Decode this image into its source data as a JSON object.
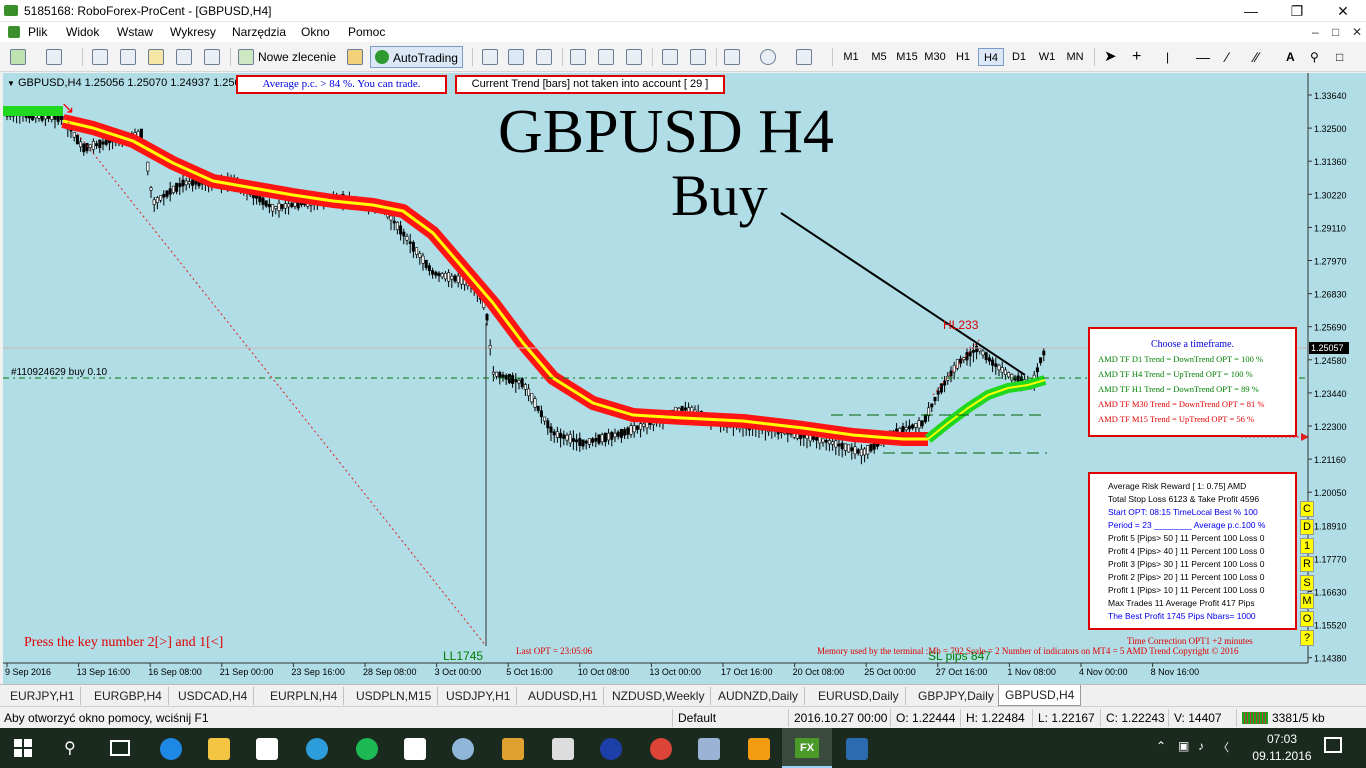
{
  "window": {
    "title": "5185168: RoboForex-ProCent - [GBPUSD,H4]"
  },
  "menu": {
    "items": [
      "Plik",
      "Widok",
      "Wstaw",
      "Wykresy",
      "Narzędzia",
      "Okno",
      "Pomoc"
    ]
  },
  "toolbar": {
    "new_order": "Nowe zlecenie",
    "autotrading": "AutoTrading",
    "timeframes": [
      "M1",
      "M5",
      "M15",
      "M30",
      "H1",
      "H4",
      "D1",
      "W1",
      "MN"
    ],
    "selected_tf": "H4"
  },
  "chart": {
    "info": "GBPUSD,H4  1.25056 1.25070 1.24937 1.25057",
    "box_avg": "Average p.c. > 84 %.  You can trade.",
    "box_trend": "Current Trend [bars] not taken into account [ 29 ]",
    "big_title": "GBPUSD H4",
    "big_signal": "Buy",
    "order_line": "#110924629 buy 0.10",
    "hl_label": "HL233",
    "ll_label": "LL1745",
    "sl_label": "SL pips 847",
    "press_key": "Press the key number 2[>] and 1[<]",
    "last_opt": "Last OPT = 23:05:06",
    "memory": "Memory used by the terminal :Mb = 792  Scale = 2   Number of indicators on MT4 = 5 AMD Trend Copyright © 2016",
    "time_corr": "Time Correction OPT1 +2 minutes",
    "current_price": "1.25057",
    "price_axis": [
      "1.33640",
      "1.32500",
      "1.31360",
      "1.30220",
      "1.29110",
      "1.27970",
      "1.26830",
      "1.25690",
      "1.24580",
      "1.23440",
      "1.22300",
      "1.21160",
      "1.20050",
      "1.18910",
      "1.17770",
      "1.16630",
      "1.15520",
      "1.14380"
    ],
    "time_axis": [
      "9 Sep 2016",
      "13 Sep 16:00",
      "16 Sep 08:00",
      "21 Sep 00:00",
      "23 Sep 16:00",
      "28 Sep 08:00",
      "3 Oct 00:00",
      "5 Oct 16:00",
      "10 Oct 08:00",
      "13 Oct 00:00",
      "17 Oct 16:00",
      "20 Oct 08:00",
      "25 Oct 00:00",
      "27 Oct 16:00",
      "1 Nov 08:00",
      "4 Nov 00:00",
      "8 Nov 16:00"
    ]
  },
  "tf_panel": {
    "title": "Choose a timeframe.",
    "rows": [
      {
        "text": "AMD TF D1  Trend = DownTrend  OPT = 100 %",
        "color": "#008000"
      },
      {
        "text": "AMD TF H4  Trend = UpTrend  OPT = 100 %",
        "color": "#008000"
      },
      {
        "text": "AMD TF H1  Trend = DownTrend  OPT = 89 %",
        "color": "#008000"
      },
      {
        "text": "AMD TF M30  Trend = DownTrend  OPT = 81 %",
        "color": "#e00000"
      },
      {
        "text": "AMD TF M15  Trend = UpTrend  OPT = 56 %",
        "color": "#e00000"
      }
    ]
  },
  "stats_panel": {
    "rows": [
      {
        "text": "Average Risk Reward [ 1: 0.75]  AMD",
        "color": "#000000"
      },
      {
        "text": "Total Stop Loss  6123 & Take Profit 4596",
        "color": "#000000"
      },
      {
        "text": "Start OPT: 08:15 TimeLocal  Best %  100",
        "color": "#0000ee"
      },
      {
        "text": "Period = 23 ________  Average p.c.100 %",
        "color": "#0000ee"
      },
      {
        "text": "Profit 5 [Pips> 50 ] 11 Percent 100 Loss 0",
        "color": "#000000"
      },
      {
        "text": "Profit 4 [Pips> 40 ] 11 Percent 100 Loss 0",
        "color": "#000000"
      },
      {
        "text": "Profit 3 [Pips> 30 ] 11 Percent 100 Loss 0",
        "color": "#000000"
      },
      {
        "text": "Profit 2 [Pips> 20 ] 11 Percent 100 Loss 0",
        "color": "#000000"
      },
      {
        "text": "Profit 1 [Pips> 10 ] 11 Percent 100 Loss 0",
        "color": "#000000"
      },
      {
        "text": "Max Trades 11   Average Profit 417 Pips",
        "color": "#000000"
      },
      {
        "text": "The Best Profit 1745 Pips Nbars= 1000",
        "color": "#0000ee"
      }
    ]
  },
  "side_buttons": [
    "C",
    "D",
    "1",
    "R",
    "S",
    "M",
    "O",
    "?"
  ],
  "tabs": [
    "EURJPY,H1",
    "EURGBP,H4",
    "USDCAD,H4",
    "EURPLN,H4",
    "USDPLN,M15",
    "USDJPY,H1",
    "AUDUSD,H1",
    "NZDUSD,Weekly",
    "AUDNZD,Daily",
    "EURUSD,Daily",
    "GBPJPY,Daily",
    "GBPUSD,H4"
  ],
  "active_tab": "GBPUSD,H4",
  "status": {
    "help": "Aby otworzyć okno pomocy, wciśnij F1",
    "profile": "Default",
    "datetime": "2016.10.27 00:00",
    "open": "O: 1.22444",
    "high": "H: 1.22484",
    "low": "L: 1.22167",
    "close": "C: 1.22243",
    "volume": "V: 14407",
    "traffic": "3381/5 kb"
  },
  "taskbar": {
    "time": "07:03",
    "date": "09.11.2016"
  }
}
